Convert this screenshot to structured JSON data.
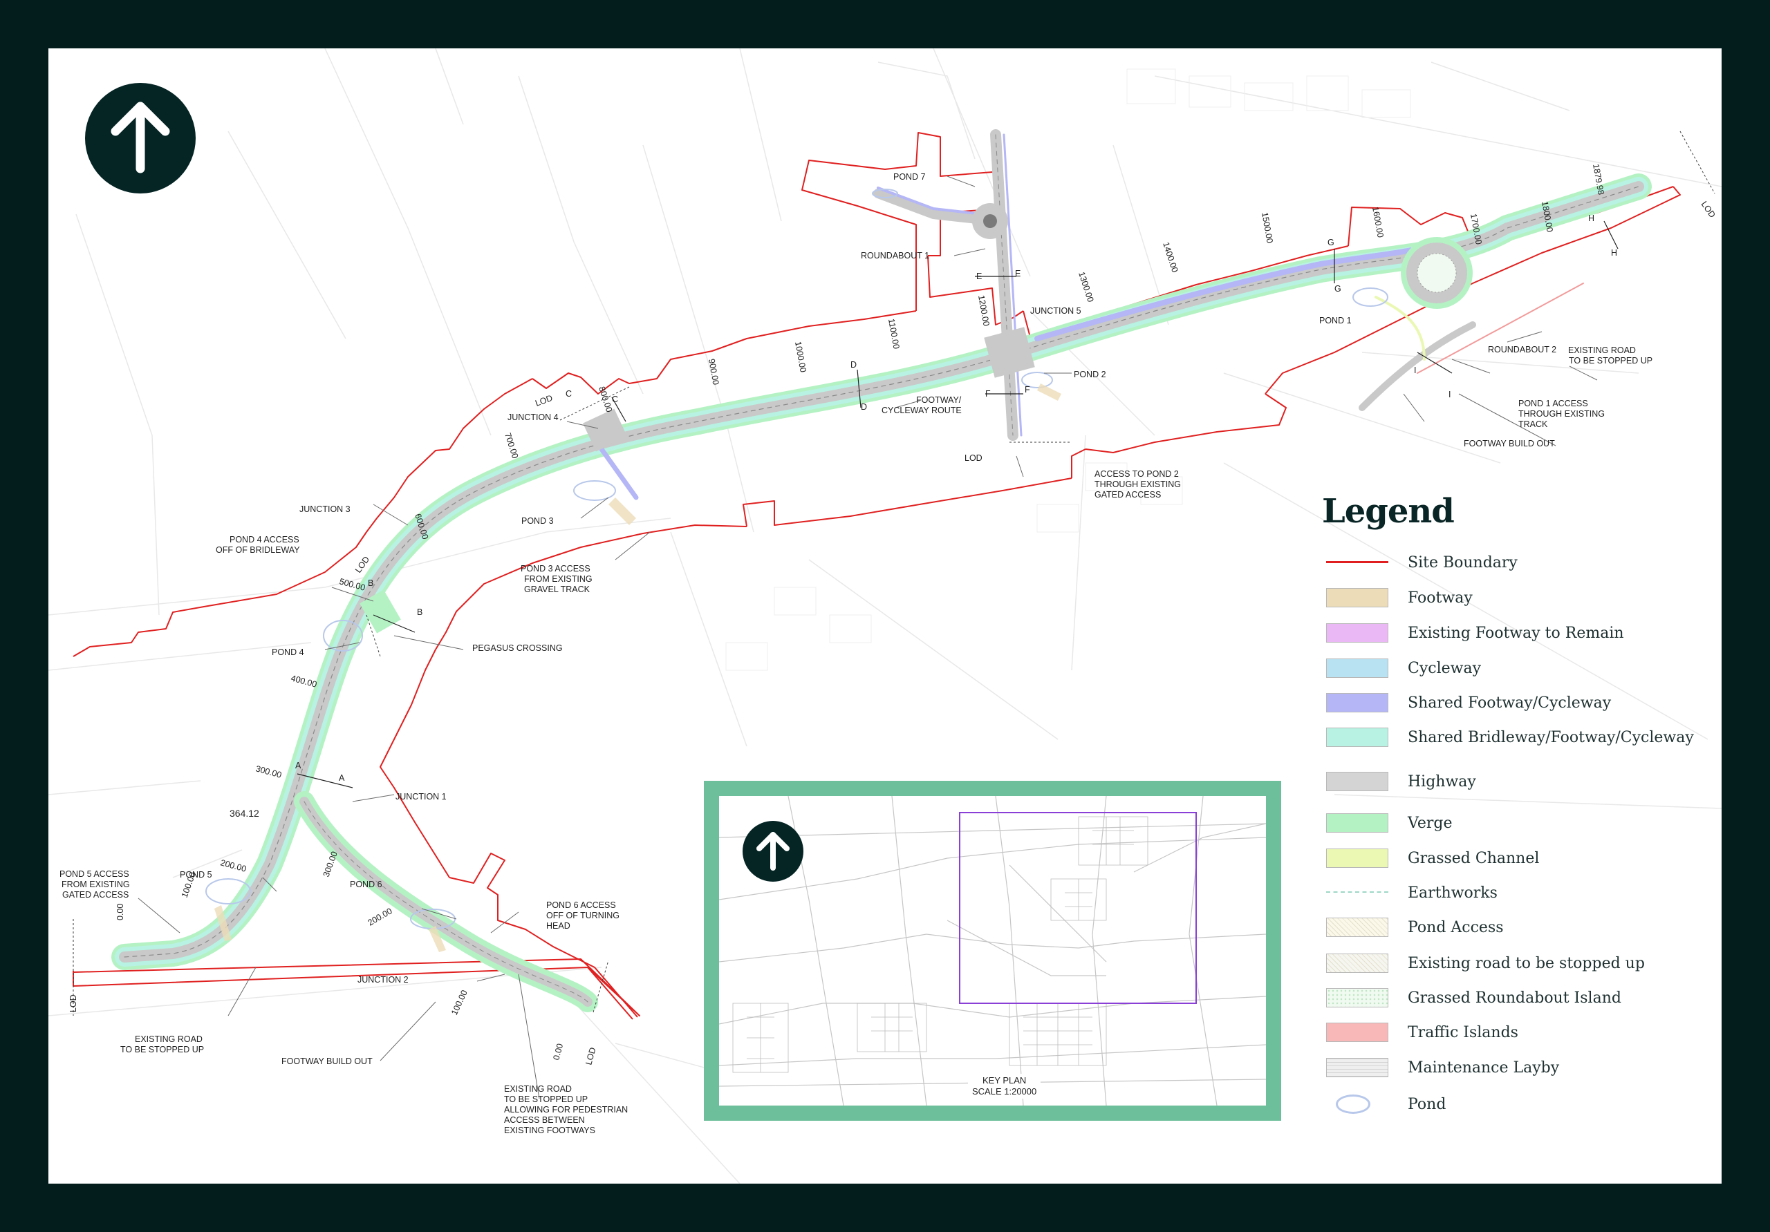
{
  "sheet": {
    "background": "#031c1c",
    "paper": "#ffffff"
  },
  "north_arrow": {
    "icon": "north-arrow-icon"
  },
  "labels": {
    "pond7": "POND 7",
    "roundabout1": "ROUNDABOUT 1",
    "junction5": "JUNCTION 5",
    "pond2": "POND 2",
    "footway_cycleway_1": "FOOTWAY/",
    "footway_cycleway_2": "CYCLEWAY ROUTE",
    "lod_mid": "LOD",
    "access_pond2_1": "ACCESS TO POND 2",
    "access_pond2_2": "THROUGH EXISTING",
    "access_pond2_3": "GATED ACCESS",
    "junction4": "JUNCTION 4",
    "lod_j4": "LOD",
    "pond3": "POND 3",
    "pond3_access_1": "POND 3 ACCESS",
    "pond3_access_2": "FROM EXISTING",
    "pond3_access_3": "GRAVEL TRACK",
    "junction3": "JUNCTION 3",
    "pond4_access_1": "POND 4 ACCESS",
    "pond4_access_2": "OFF OF BRIDLEWAY",
    "lod_j3": "LOD",
    "pegasus": "PEGASUS CROSSING",
    "pond4": "POND 4",
    "junction1": "JUNCTION 1",
    "chain_36412": "364.12",
    "pond5": "POND 5",
    "pond5_access_1": "POND 5 ACCESS",
    "pond5_access_2": "FROM EXISTING",
    "pond5_access_3": "GATED ACCESS",
    "pond6": "POND 6",
    "pond6_access_1": "POND 6 ACCESS",
    "pond6_access_2": "OFF OF TURNING",
    "pond6_access_3": "HEAD",
    "junction2": "JUNCTION 2",
    "existing_road_w_1": "EXISTING ROAD",
    "existing_road_w_2": "TO BE STOPPED UP",
    "footway_buildout_w": "FOOTWAY BUILD OUT",
    "existing_road_s_1": "EXISTING ROAD",
    "existing_road_s_2": "TO BE STOPPED UP",
    "existing_road_s_3": "ALLOWING FOR PEDESTRIAN",
    "existing_road_s_4": "ACCESS BETWEEN",
    "existing_road_s_5": "EXISTING FOOTWAYS",
    "lod_w": "LOD",
    "lod_s": "LOD",
    "lod_ne": "LOD",
    "pond1": "POND 1",
    "roundabout2": "ROUNDABOUT 2",
    "existing_road_e_1": "EXISTING ROAD",
    "existing_road_e_2": "TO BE STOPPED UP",
    "pond1_access_1": "POND 1 ACCESS",
    "pond1_access_2": "THROUGH EXISTING",
    "pond1_access_3": "TRACK",
    "footway_buildout_e": "FOOTWAY BUILD OUT"
  },
  "chainages": {
    "c0_w": "0.00",
    "c100_w": "100.00",
    "c200_w": "200.00",
    "c300_w": "300.00",
    "c400": "400.00",
    "c500": "500.00",
    "c600": "600.00",
    "c700": "700.00",
    "c800": "800.00",
    "c900": "900.00",
    "c1000": "1000.00",
    "c1100": "1100.00",
    "c1200": "1200.00",
    "c1300": "1300.00",
    "c1400": "1400.00",
    "c1500": "1500.00",
    "c1600": "1600.00",
    "c1700": "1700.00",
    "c1800": "1800.00",
    "c1879": "1879.98",
    "c300_s": "300.00",
    "c200_s": "200.00",
    "c100_s": "100.00",
    "c0_s": "0.00"
  },
  "sections": {
    "A": "A",
    "B": "B",
    "C": "C",
    "D": "D",
    "E": "E",
    "F": "F",
    "G": "G",
    "H": "H",
    "I": "I"
  },
  "legend": {
    "title": "Legend",
    "items": [
      {
        "label": "Site Boundary",
        "color": "#e02020",
        "kind": "line"
      },
      {
        "label": "Footway",
        "color": "#ecdcb8",
        "kind": "fill"
      },
      {
        "label": "Existing Footway to Remain",
        "color": "#eab8f4",
        "kind": "fill"
      },
      {
        "label": "Cycleway",
        "color": "#b8e2f2",
        "kind": "fill"
      },
      {
        "label": "Shared Footway/Cycleway",
        "color": "#b4b6f6",
        "kind": "fill"
      },
      {
        "label": "Shared Bridleway/Footway/Cycleway",
        "color": "#b8f2e2",
        "kind": "fill"
      },
      {
        "label": "Highway",
        "color": "#d4d4d4",
        "kind": "fill"
      },
      {
        "label": "Verge",
        "color": "#b4f2c4",
        "kind": "fill"
      },
      {
        "label": "Grassed Channel",
        "color": "#eaf8b4",
        "kind": "fill"
      },
      {
        "label": "Earthworks",
        "color": "#9fd8c8",
        "kind": "dash"
      },
      {
        "label": "Pond Access",
        "color": "#fbf8ea",
        "kind": "hatch"
      },
      {
        "label": "Existing road to be stopped up",
        "color": "#f6f6f0",
        "kind": "hatch"
      },
      {
        "label": "Grassed Roundabout Island",
        "color": "#f0faf0",
        "kind": "dots"
      },
      {
        "label": "Traffic Islands",
        "color": "#f8b8b8",
        "kind": "fill"
      },
      {
        "label": "Maintenance Layby",
        "color": "#efefef",
        "kind": "grid"
      },
      {
        "label": "Pond",
        "color": "#b8c8ea",
        "kind": "ellipse"
      }
    ]
  },
  "key_plan": {
    "label_1": "KEY PLAN",
    "label_2": "SCALE 1:20000",
    "frame_color": "#6dbf9b",
    "extent_color": "#8a3fd6"
  }
}
